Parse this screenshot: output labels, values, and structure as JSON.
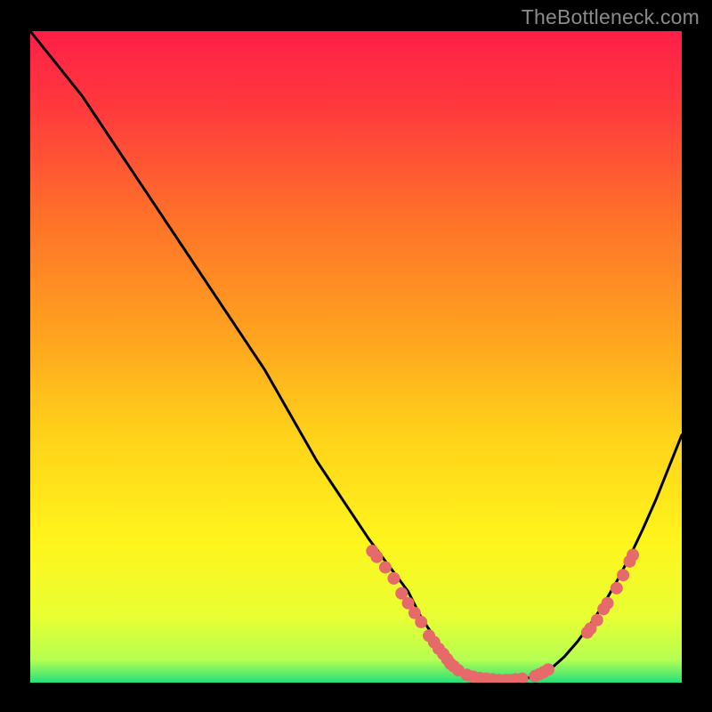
{
  "watermark": "TheBottleneck.com",
  "colors": {
    "gradient_stops": [
      {
        "offset": 0.0,
        "color": "#ff1f47"
      },
      {
        "offset": 0.12,
        "color": "#ff3a3d"
      },
      {
        "offset": 0.28,
        "color": "#ff6f2a"
      },
      {
        "offset": 0.45,
        "color": "#ff9e20"
      },
      {
        "offset": 0.62,
        "color": "#ffd21a"
      },
      {
        "offset": 0.78,
        "color": "#fff41c"
      },
      {
        "offset": 0.9,
        "color": "#e8ff33"
      },
      {
        "offset": 0.965,
        "color": "#b5ff52"
      },
      {
        "offset": 1.0,
        "color": "#24e07a"
      }
    ],
    "curve": "#000000",
    "marker": "#e76a6a"
  },
  "chart_data": {
    "type": "line",
    "title": "",
    "xlabel": "",
    "ylabel": "",
    "x": [
      0.0,
      0.04,
      0.08,
      0.12,
      0.16,
      0.2,
      0.24,
      0.28,
      0.32,
      0.36,
      0.4,
      0.44,
      0.48,
      0.5,
      0.52,
      0.55,
      0.58,
      0.6,
      0.62,
      0.64,
      0.66,
      0.68,
      0.7,
      0.72,
      0.74,
      0.76,
      0.78,
      0.8,
      0.82,
      0.84,
      0.86,
      0.88,
      0.9,
      0.92,
      0.94,
      0.96,
      0.98,
      1.0
    ],
    "y": [
      1.0,
      0.95,
      0.9,
      0.84,
      0.78,
      0.72,
      0.66,
      0.6,
      0.54,
      0.48,
      0.41,
      0.34,
      0.28,
      0.25,
      0.22,
      0.18,
      0.14,
      0.1,
      0.07,
      0.04,
      0.02,
      0.01,
      0.006,
      0.004,
      0.004,
      0.006,
      0.012,
      0.022,
      0.04,
      0.063,
      0.09,
      0.12,
      0.155,
      0.193,
      0.235,
      0.28,
      0.33,
      0.38
    ],
    "xlim": [
      0,
      1
    ],
    "ylim": [
      0,
      1
    ],
    "markers": [
      {
        "x": 0.525,
        "y": 0.202
      },
      {
        "x": 0.532,
        "y": 0.193
      },
      {
        "x": 0.545,
        "y": 0.177
      },
      {
        "x": 0.558,
        "y": 0.16
      },
      {
        "x": 0.57,
        "y": 0.137
      },
      {
        "x": 0.58,
        "y": 0.122
      },
      {
        "x": 0.59,
        "y": 0.107
      },
      {
        "x": 0.6,
        "y": 0.093
      },
      {
        "x": 0.612,
        "y": 0.072
      },
      {
        "x": 0.62,
        "y": 0.062
      },
      {
        "x": 0.627,
        "y": 0.052
      },
      {
        "x": 0.634,
        "y": 0.044
      },
      {
        "x": 0.64,
        "y": 0.036
      },
      {
        "x": 0.645,
        "y": 0.029
      },
      {
        "x": 0.65,
        "y": 0.025
      },
      {
        "x": 0.657,
        "y": 0.019
      },
      {
        "x": 0.67,
        "y": 0.012
      },
      {
        "x": 0.68,
        "y": 0.009
      },
      {
        "x": 0.69,
        "y": 0.007
      },
      {
        "x": 0.7,
        "y": 0.006
      },
      {
        "x": 0.71,
        "y": 0.005
      },
      {
        "x": 0.72,
        "y": 0.004
      },
      {
        "x": 0.73,
        "y": 0.004
      },
      {
        "x": 0.738,
        "y": 0.004
      },
      {
        "x": 0.745,
        "y": 0.005
      },
      {
        "x": 0.755,
        "y": 0.006
      },
      {
        "x": 0.775,
        "y": 0.01
      },
      {
        "x": 0.782,
        "y": 0.013
      },
      {
        "x": 0.788,
        "y": 0.016
      },
      {
        "x": 0.795,
        "y": 0.02
      },
      {
        "x": 0.855,
        "y": 0.077
      },
      {
        "x": 0.86,
        "y": 0.083
      },
      {
        "x": 0.87,
        "y": 0.096
      },
      {
        "x": 0.88,
        "y": 0.113
      },
      {
        "x": 0.886,
        "y": 0.122
      },
      {
        "x": 0.9,
        "y": 0.145
      },
      {
        "x": 0.91,
        "y": 0.165
      },
      {
        "x": 0.92,
        "y": 0.186
      },
      {
        "x": 0.925,
        "y": 0.196
      }
    ]
  }
}
